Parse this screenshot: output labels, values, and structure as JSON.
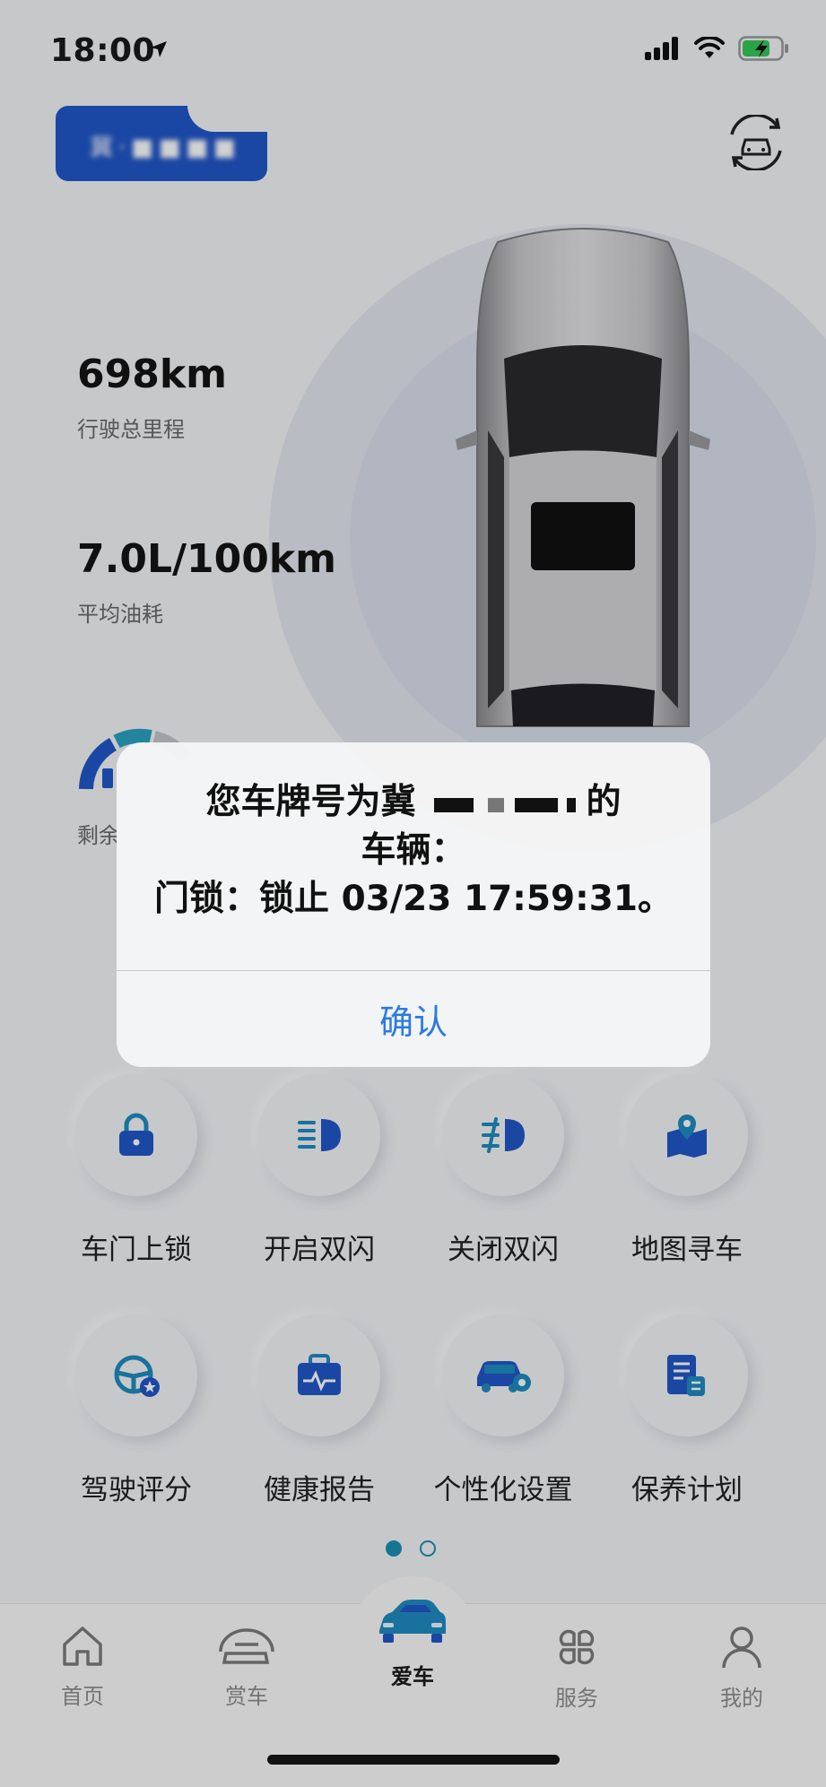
{
  "status_bar": {
    "time": "18:00"
  },
  "header": {
    "plate_text": "冀·■■■■"
  },
  "stats": {
    "mileage_value": "698km",
    "mileage_label": "行驶总里程",
    "fuel_value": "7.0L/100km",
    "fuel_label": "平均油耗",
    "remaining_label": "剩余"
  },
  "actions": [
    {
      "label": "车门上锁",
      "icon": "lock-icon"
    },
    {
      "label": "开启双闪",
      "icon": "headlight-on-icon"
    },
    {
      "label": "关闭双闪",
      "icon": "headlight-off-icon"
    },
    {
      "label": "地图寻车",
      "icon": "map-pin-icon"
    },
    {
      "label": "驾驶评分",
      "icon": "steering-wheel-icon"
    },
    {
      "label": "健康报告",
      "icon": "health-report-icon"
    },
    {
      "label": "个性化设置",
      "icon": "car-settings-icon"
    },
    {
      "label": "保养计划",
      "icon": "maintenance-plan-icon"
    }
  ],
  "pager": {
    "count": 2,
    "active": 1
  },
  "tabs": [
    {
      "label": "首页",
      "icon": "home-icon"
    },
    {
      "label": "赏车",
      "icon": "car-front-icon"
    },
    {
      "label": "爱车",
      "icon": "my-car-icon"
    },
    {
      "label": "服务",
      "icon": "services-icon"
    },
    {
      "label": "我的",
      "icon": "profile-icon"
    }
  ],
  "alert": {
    "line1_prefix": "您车牌号为冀",
    "line1_suffix": "的",
    "line2": "车辆：",
    "line3": "门锁：锁止 03/23 17:59:31。",
    "confirm_label": "确认"
  },
  "colors": {
    "accent": "#2a7ae2",
    "brand_blue": "#2257c8",
    "teal": "#1e8fb3"
  }
}
